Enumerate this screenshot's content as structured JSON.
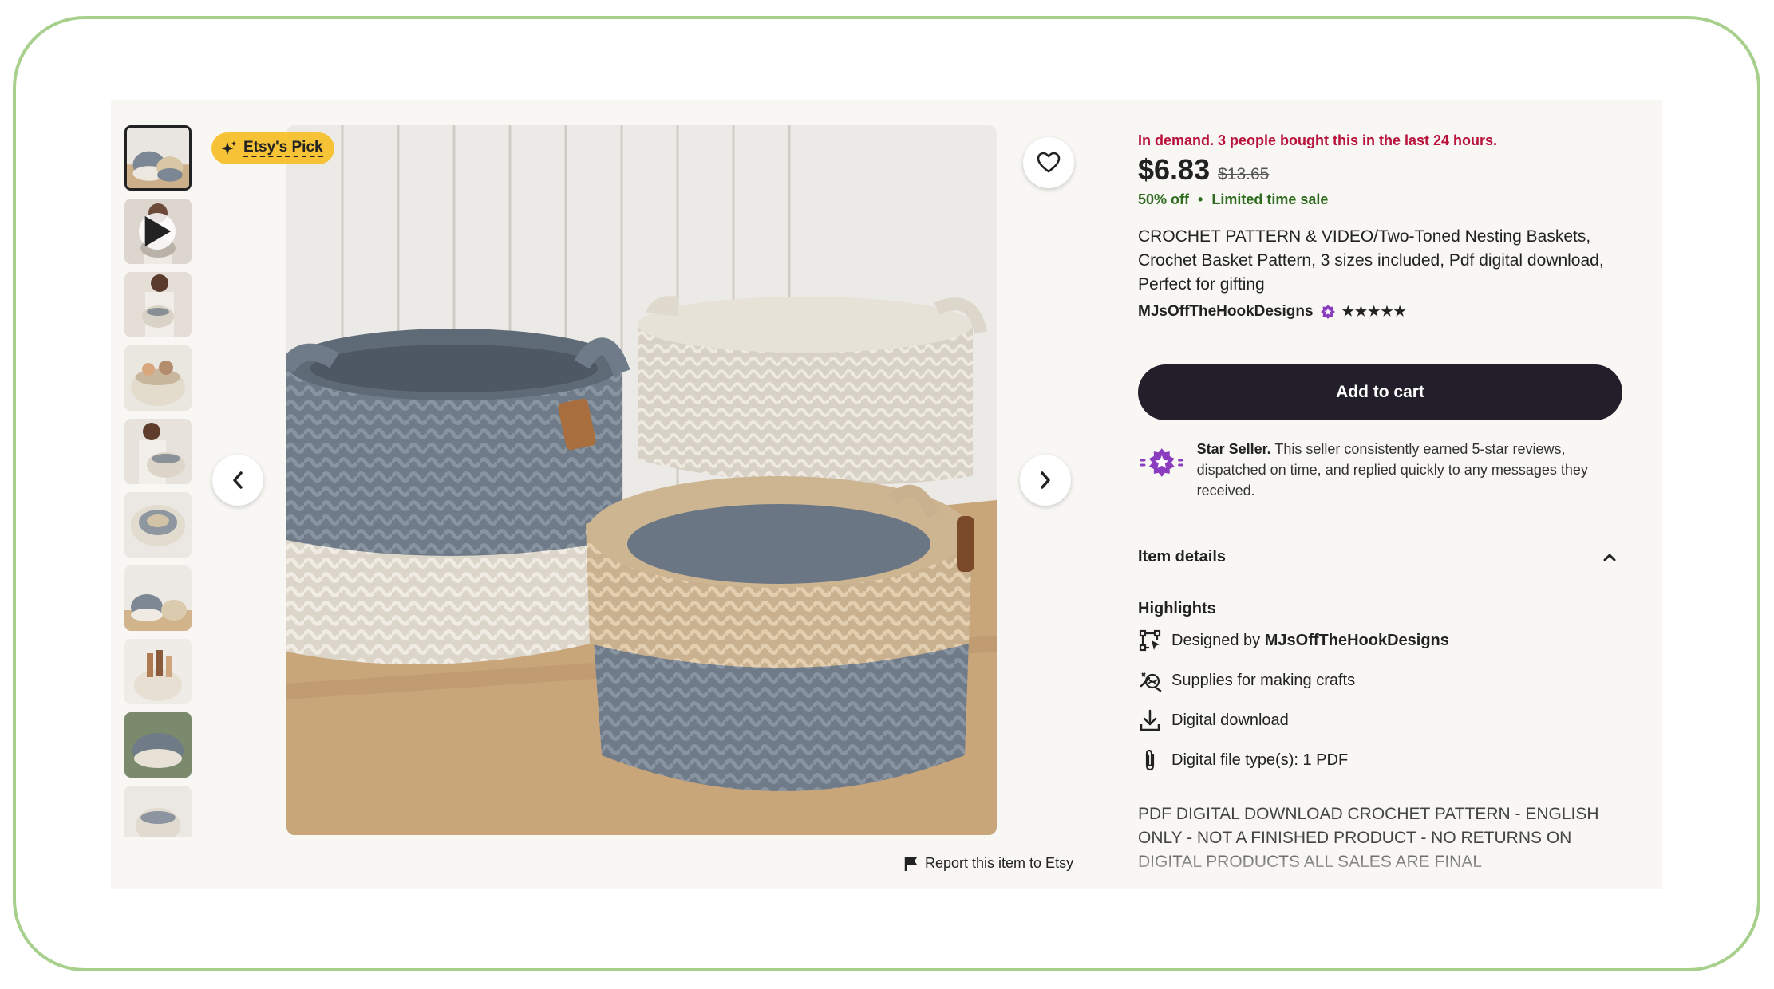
{
  "badge": {
    "label": "Etsy's Pick"
  },
  "report": {
    "label": "Report this item to Etsy"
  },
  "listing": {
    "demand_text": "In demand. 3 people bought this in the last 24 hours.",
    "price": "$6.83",
    "original_price": "$13.65",
    "discount": "50% off",
    "sale_note": "Limited time sale",
    "sale_separator": "•",
    "title": "CROCHET PATTERN & VIDEO/Two-Toned Nesting Baskets, Crochet Basket Pattern, 3 sizes included, Pdf digital download, Perfect for gifting",
    "shop_name": "MJsOffTheHookDesigns",
    "rating_stars": "★★★★★",
    "add_to_cart_label": "Add to cart"
  },
  "star_seller": {
    "label": "Star Seller.",
    "text": " This seller consistently earned 5-star reviews, dispatched on time, and replied quickly to any messages they received."
  },
  "item_details": {
    "header": "Item details",
    "highlights_title": "Highlights",
    "designed_by_prefix": "Designed by ",
    "designed_by_shop": "MJsOffTheHookDesigns",
    "highlights": [
      {
        "icon": "design-frame-icon",
        "label": "Supplies for making crafts"
      },
      {
        "icon": "download-icon",
        "label": "Digital download"
      },
      {
        "icon": "paperclip-icon",
        "label": "Digital file type(s): 1 PDF"
      }
    ],
    "description": "PDF DIGITAL DOWNLOAD CROCHET PATTERN - ENGLISH ONLY - NOT A FINISHED PRODUCT - NO RETURNS ON DIGITAL PRODUCTS ALL SALES ARE FINAL"
  },
  "gallery": {
    "thumbnail_count": 10,
    "active_index": 0,
    "video_thumbnail_index": 1
  },
  "colors": {
    "accent_badge": "#f6c236",
    "demand_red": "#b8123b",
    "sale_green": "#2e6b1e",
    "cart_button": "#221f2a",
    "star_seller_purple": "#8a3dbf"
  }
}
